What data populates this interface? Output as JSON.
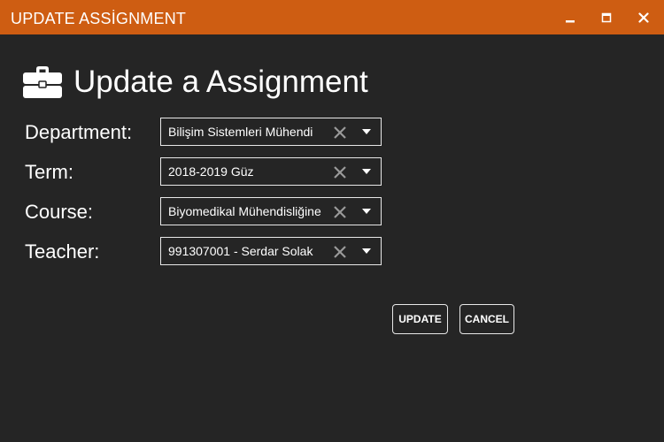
{
  "window": {
    "title": "UPDATE ASSİGNMENT",
    "controls": [
      "minimize-icon",
      "maximize-icon",
      "close-icon"
    ],
    "titlebar_color": "#ce5d12",
    "background_color": "#252525"
  },
  "heading": {
    "icon": "briefcase-icon",
    "text": "Update a Assignment"
  },
  "form": {
    "department": {
      "label": "Department:",
      "value": "Bilişim Sistemleri Mühendi"
    },
    "term": {
      "label": "Term:",
      "value": "2018-2019 Güz"
    },
    "course": {
      "label": "Course:",
      "value": "Biyomedikal Mühendisliğine"
    },
    "teacher": {
      "label": "Teacher:",
      "value": "991307001 - Serdar Solak"
    }
  },
  "buttons": {
    "update": "UPDATE",
    "cancel": "CANCEL"
  }
}
